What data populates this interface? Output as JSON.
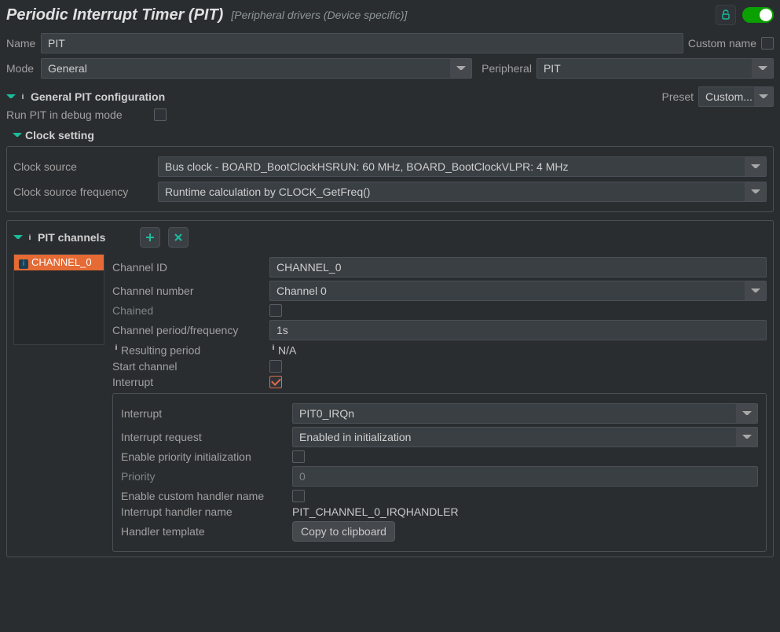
{
  "header": {
    "title": "Periodic Interrupt Timer (PIT)",
    "subtitle": "[Peripheral drivers (Device specific)]"
  },
  "name_row": {
    "label": "Name",
    "value": "PIT",
    "custom_name_label": "Custom name"
  },
  "mode_row": {
    "mode_label": "Mode",
    "mode_value": "General",
    "periph_label": "Peripheral",
    "periph_value": "PIT"
  },
  "general": {
    "section_title": "General PIT configuration",
    "preset_label": "Preset",
    "preset_value": "Custom...",
    "debug_label": "Run PIT in debug mode",
    "clock_section": "Clock setting",
    "clock_source_label": "Clock source",
    "clock_source_value": "Bus clock - BOARD_BootClockHSRUN: 60 MHz, BOARD_BootClockVLPR: 4 MHz",
    "clock_freq_label": "Clock source frequency",
    "clock_freq_value": "Runtime calculation by CLOCK_GetFreq()"
  },
  "channels": {
    "section_title": "PIT channels",
    "list": [
      "CHANNEL_0"
    ],
    "detail": {
      "channel_id_label": "Channel ID",
      "channel_id_value": "CHANNEL_0",
      "channel_number_label": "Channel number",
      "channel_number_value": "Channel 0",
      "chained_label": "Chained",
      "period_label": "Channel period/frequency",
      "period_value": "1s",
      "resulting_label": "Resulting period",
      "resulting_value": "N/A",
      "start_label": "Start channel",
      "interrupt_label": "Interrupt"
    },
    "interrupt": {
      "irq_label": "Interrupt",
      "irq_value": "PIT0_IRQn",
      "req_label": "Interrupt request",
      "req_value": "Enabled in initialization",
      "prio_init_label": "Enable priority initialization",
      "prio_label": "Priority",
      "prio_value": "0",
      "custom_handler_label": "Enable custom handler name",
      "handler_name_label": "Interrupt handler name",
      "handler_name_value": "PIT_CHANNEL_0_IRQHANDLER",
      "handler_tmpl_label": "Handler template",
      "handler_tmpl_button": "Copy to clipboard"
    }
  }
}
